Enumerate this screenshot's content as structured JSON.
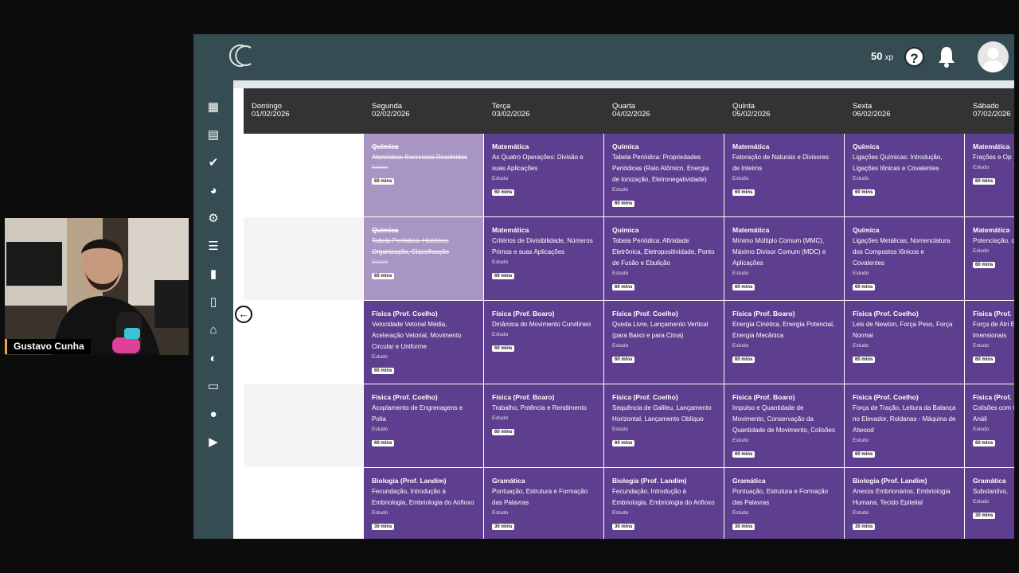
{
  "topbar": {
    "xp_value": "50",
    "xp_unit": "xp",
    "help_label": "?"
  },
  "sidebar": {
    "icons": [
      "calendar-check-icon",
      "calendar-icon",
      "check-icon",
      "dashboard-icon",
      "gear-icon",
      "list-icon",
      "book-icon",
      "file-icon",
      "institution-icon",
      "brain-icon",
      "inbox-icon",
      "chat-icon",
      "play-icon"
    ]
  },
  "webcam": {
    "name": "Gustavo Cunha"
  },
  "days": [
    {
      "name": "Domingo",
      "date": "01/02/2026"
    },
    {
      "name": "Segunda",
      "date": "02/02/2026"
    },
    {
      "name": "Terça",
      "date": "03/02/2026"
    },
    {
      "name": "Quarta",
      "date": "04/02/2026"
    },
    {
      "name": "Quinta",
      "date": "05/02/2026"
    },
    {
      "name": "Sexta",
      "date": "06/02/2026"
    },
    {
      "name": "Sábado",
      "date": "07/02/2026"
    }
  ],
  "rows": [
    [
      {
        "subject": "Química",
        "topic": "Atomística: Exercícios Resolvidos",
        "kind": "Estudo",
        "mins": "60 mins",
        "done": true
      },
      {
        "subject": "Matemática",
        "topic": "As Quatro Operações: Divisão e suas Aplicações",
        "kind": "Estudo",
        "mins": "60 mins",
        "done": false
      },
      {
        "subject": "Química",
        "topic": "Tabela Periódica: Propriedades Periódicas (Raio Atômico, Energia de Ionização, Eletronegatividade)",
        "kind": "Estudo",
        "mins": "60 mins",
        "done": false
      },
      {
        "subject": "Matemática",
        "topic": "Fatoração de Naturais e Divisores de Inteiros",
        "kind": "Estudo",
        "mins": "60 mins",
        "done": false
      },
      {
        "subject": "Química",
        "topic": "Ligações Químicas: Introdução, Ligações Iônicas e Covalentes",
        "kind": "Estudo",
        "mins": "60 mins",
        "done": false
      },
      {
        "subject": "Matemática",
        "topic": "Frações e Op",
        "kind": "Estudo",
        "mins": "60 mins",
        "done": false
      }
    ],
    [
      {
        "subject": "Química",
        "topic": "Tabela Periódica: Histórico, Organização, Classificação",
        "kind": "Estudo",
        "mins": "60 mins",
        "done": true
      },
      {
        "subject": "Matemática",
        "topic": "Critérios de Divisibilidade, Números Primos e suas Aplicações",
        "kind": "Estudo",
        "mins": "60 mins",
        "done": false
      },
      {
        "subject": "Química",
        "topic": "Tabela Periódica: Afinidade Eletrônica, Eletropositividade, Ponto de Fusão e Ebulição",
        "kind": "Estudo",
        "mins": "60 mins",
        "done": false
      },
      {
        "subject": "Matemática",
        "topic": "Mínimo Múltiplo Comum (MMC), Máximo Divisor Comum (MDC) e Aplicações",
        "kind": "Estudo",
        "mins": "60 mins",
        "done": false
      },
      {
        "subject": "Química",
        "topic": "Ligações Metálicas, Nomenclatura dos Compostos Iônicos e Covalentes",
        "kind": "Estudo",
        "mins": "60 mins",
        "done": false
      },
      {
        "subject": "Matemática",
        "topic": "Potenciação, otação Cientí",
        "kind": "Estudo",
        "mins": "60 mins",
        "done": false
      }
    ],
    [
      {
        "subject": "Física (Prof. Coelho)",
        "topic": "Velocidade Vetorial Média, Aceleração Vetorial, Movimento Circular e Uniforme",
        "kind": "Estudo",
        "mins": "60 mins",
        "done": false
      },
      {
        "subject": "Física (Prof. Boaro)",
        "topic": "Dinâmica do Movimento Curvilíneo",
        "kind": "Estudo",
        "mins": "60 mins",
        "done": false
      },
      {
        "subject": "Física (Prof. Coelho)",
        "topic": "Queda Livre, Lançamento Vertical (para Baixo e para Cima)",
        "kind": "Estudo",
        "mins": "60 mins",
        "done": false
      },
      {
        "subject": "Física (Prof. Boaro)",
        "topic": "Energia Cinética, Energia Potencial, Energia Mecânica",
        "kind": "Estudo",
        "mins": "60 mins",
        "done": false
      },
      {
        "subject": "Física (Prof. Coelho)",
        "topic": "Leis de Newton, Força Peso, Força Normal",
        "kind": "Estudo",
        "mins": "60 mins",
        "done": false
      },
      {
        "subject": "Física (Prof.",
        "topic": "Força de Atri Energia Mecâ imensionais",
        "kind": "Estudo",
        "mins": "60 mins",
        "done": false
      }
    ],
    [
      {
        "subject": "Física (Prof. Coelho)",
        "topic": "Acoplamento de Engrenagens e Polia",
        "kind": "Estudo",
        "mins": "60 mins",
        "done": false
      },
      {
        "subject": "Física (Prof. Boaro)",
        "topic": "Trabalho, Potência e Rendimento",
        "kind": "Estudo",
        "mins": "60 mins",
        "done": false
      },
      {
        "subject": "Física (Prof. Coelho)",
        "topic": "Sequência de Galileu, Lançamento Horizontal, Lançamento Oblíquo",
        "kind": "Estudo",
        "mins": "60 mins",
        "done": false
      },
      {
        "subject": "Física (Prof. Boaro)",
        "topic": "Impulso e Quantidade de Movimento, Conservação da Quantidade de Movimento, Colisões",
        "kind": "Estudo",
        "mins": "60 mins",
        "done": false
      },
      {
        "subject": "Física (Prof. Coelho)",
        "topic": "Força de Tração, Leitura da Balança no Elevador, Roldanas - Máquina de Atwood",
        "kind": "Estudo",
        "mins": "60 mins",
        "done": false
      },
      {
        "subject": "Física (Prof.",
        "topic": "Colisões com Centro de Ma vidade, Análi",
        "kind": "Estudo",
        "mins": "60 mins",
        "done": false
      }
    ],
    [
      {
        "subject": "Biologia (Prof. Landim)",
        "topic": "Fecundação, Introdução à Embriologia, Embriologia do Anfioxo",
        "kind": "Estudo",
        "mins": "30 mins",
        "done": false
      },
      {
        "subject": "Gramática",
        "topic": "Pontuação, Estrutura e Formação das Palavras",
        "kind": "Estudo",
        "mins": "30 mins",
        "done": false
      },
      {
        "subject": "Biologia (Prof. Landim)",
        "topic": "Fecundação, Introdução à Embriologia, Embriologia do Anfioxo",
        "kind": "Estudo",
        "mins": "30 mins",
        "done": false
      },
      {
        "subject": "Gramática",
        "topic": "Pontuação, Estrutura e Formação das Palavras",
        "kind": "Estudo",
        "mins": "30 mins",
        "done": false
      },
      {
        "subject": "Biologia (Prof. Landim)",
        "topic": "Anexos Embrionários, Embriologia Humana, Tecido Epitelial",
        "kind": "Estudo",
        "mins": "30 mins",
        "done": false
      },
      {
        "subject": "Gramática",
        "topic": "Substantivo,",
        "kind": "Estudo",
        "mins": "30 mins",
        "done": false
      }
    ]
  ]
}
